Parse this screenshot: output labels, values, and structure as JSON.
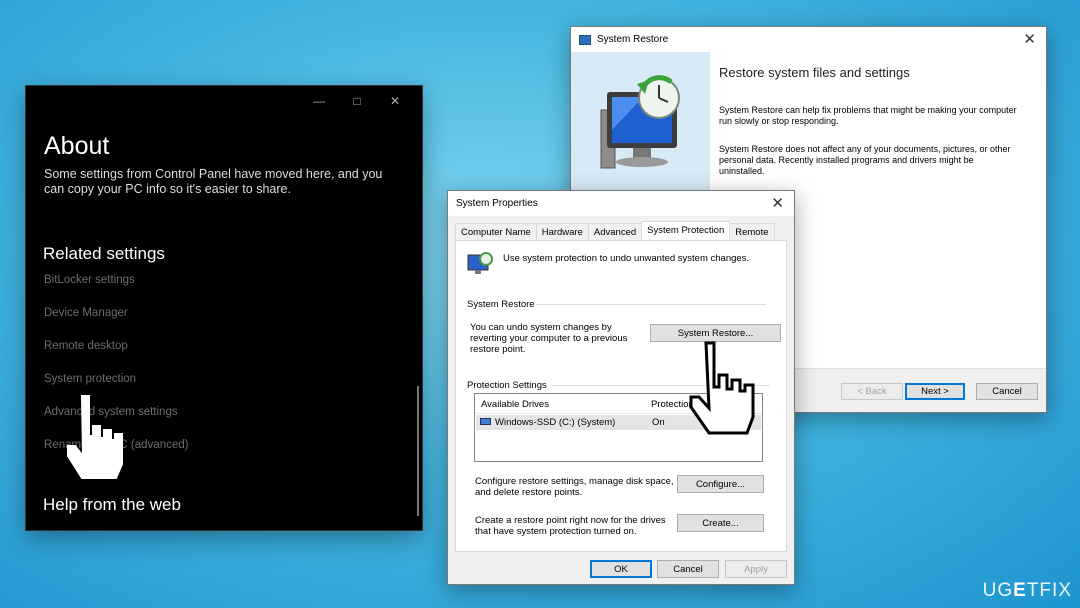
{
  "settings_window": {
    "title": "About",
    "description": "Some settings from Control Panel have moved here, and you can copy your PC info so it's easier to share.",
    "related_heading": "Related settings",
    "links": [
      "BitLocker settings",
      "Device Manager",
      "Remote desktop",
      "System protection",
      "Advanced system settings",
      "Rename this PC (advanced)"
    ],
    "help_heading": "Help from the web",
    "caption_icons": [
      "minimize-icon",
      "maximize-icon",
      "close-icon"
    ]
  },
  "restore_window": {
    "title": "System Restore",
    "heading": "Restore system files and settings",
    "para1": "System Restore can help fix problems that might be making your computer run slowly or stop responding.",
    "para2": "System Restore does not affect any of your documents, pictures, or other personal data. Recently installed programs and drivers might be uninstalled.",
    "back_label": "< Back",
    "next_label": "Next >",
    "cancel_label": "Cancel"
  },
  "properties_window": {
    "title": "System Properties",
    "tabs": [
      "Computer Name",
      "Hardware",
      "Advanced",
      "System Protection",
      "Remote"
    ],
    "active_tab": "System Protection",
    "intro": "Use system protection to undo unwanted system changes.",
    "restore_group": "System Restore",
    "restore_text": "You can undo system changes by reverting your computer to a previous restore point.",
    "restore_button": "System Restore...",
    "protection_group": "Protection Settings",
    "columns": [
      "Available Drives",
      "Protection"
    ],
    "drives": [
      {
        "name": "Windows-SSD (C:) (System)",
        "protection": "On"
      }
    ],
    "configure_text": "Configure restore settings, manage disk space, and delete restore points.",
    "configure_button": "Configure...",
    "create_text": "Create a restore point right now for the drives that have system protection turned on.",
    "create_button": "Create...",
    "ok_label": "OK",
    "cancel_label": "Cancel",
    "apply_label": "Apply"
  },
  "watermark": {
    "prefix": "UG",
    "accent": "E",
    "suffix": "TFIX"
  },
  "colors": {
    "desktop": "#43b6e0",
    "accent": "#0078d7",
    "restore_pane": "#d9eaf7"
  }
}
